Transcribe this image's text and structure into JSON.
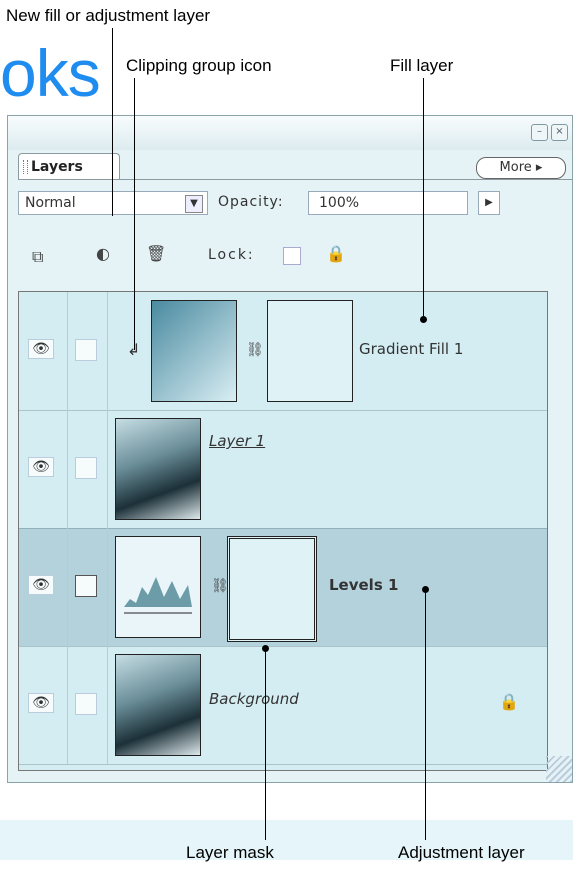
{
  "callouts": {
    "new_fill": "New fill or adjustment layer",
    "clipping": "Clipping group icon",
    "fill_layer": "Fill layer",
    "layer_mask": "Layer mask",
    "adjustment_layer": "Adjustment layer"
  },
  "brand_fragment": "oks",
  "panel": {
    "tab_label": "Layers",
    "more_label": "More ▸",
    "blend_mode": "Normal",
    "opacity_label": "Opacity:",
    "opacity_value": "100%",
    "lock_label": "Lock:"
  },
  "layers": [
    {
      "name": "Gradient Fill 1",
      "type": "fill"
    },
    {
      "name": "Layer 1",
      "type": "image"
    },
    {
      "name": "Levels 1",
      "type": "adjustment"
    },
    {
      "name": "Background",
      "type": "background"
    }
  ],
  "colors": {
    "panel_bg": "#e6f3f6",
    "list_bg": "#d4edf2",
    "brand": "#1f8cf0"
  },
  "icons": [
    "eye-icon",
    "chain-icon",
    "lock-icon",
    "new-layer-icon",
    "adjustment-layer-icon",
    "trash-icon"
  ]
}
